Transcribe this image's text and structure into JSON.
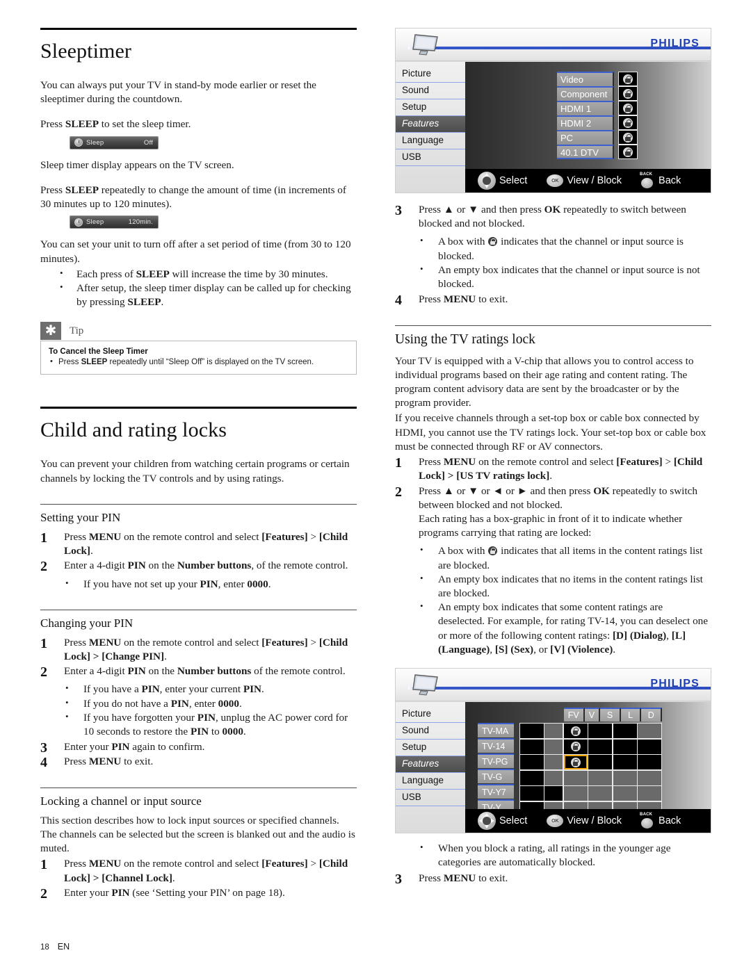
{
  "footer": {
    "page_number": "18",
    "language_code": "EN"
  },
  "left": {
    "chapter1": {
      "title": "Sleeptimer",
      "p1": "You can always put your TV in stand-by mode earlier or reset the sleeptimer during the countdown.",
      "p2_pre": "Press ",
      "p2_bold": "SLEEP",
      "p2_post": " to set the sleep timer.",
      "badge1": {
        "icon": "clock-icon",
        "label": "Sleep",
        "value": "Off"
      },
      "p3": "Sleep timer display appears on the TV screen.",
      "p4_pre": "Press ",
      "p4_bold": "SLEEP",
      "p4_post": " repeatedly to change the amount of time (in increments of 30 minutes up to 120 minutes).",
      "badge2": {
        "icon": "clock-icon",
        "label": "Sleep",
        "value": "120min."
      },
      "p5": "You can set your unit to turn off after a set period of time (from 30 to 120 minutes).",
      "bullets": [
        {
          "pre": "Each press of ",
          "bold": "SLEEP",
          "post": " will increase the time by 30 minutes."
        },
        {
          "pre": "After setup, the sleep timer display can be called up for checking by pressing ",
          "bold": "SLEEP",
          "post": "."
        }
      ],
      "tip": {
        "icon": "asterisk-icon",
        "header": "Tip",
        "title": "To Cancel the Sleep Timer",
        "body_pre": "Press ",
        "body_bold": "SLEEP",
        "body_post": " repeatedly until “Sleep Off” is displayed on the TV screen."
      }
    },
    "chapter2": {
      "title": "Child and rating locks",
      "intro": "You can prevent your children from watching certain programs or certain channels by locking the TV controls and by using ratings.",
      "sections": [
        {
          "heading": "Setting your PIN",
          "steps": [
            {
              "num": "1",
              "pre": "Press ",
              "b1": "MENU",
              "mid": " on the remote control and select ",
              "b2": "[Features]",
              "post": " > ",
              "b3": "[Child Lock]",
              "tail": "."
            },
            {
              "num": "2",
              "pre": "Enter a 4-digit ",
              "b1": "PIN",
              "mid": " on the ",
              "b2": "Number buttons",
              "post": ", of the remote control.",
              "b3": "",
              "tail": ""
            }
          ],
          "bullets": [
            {
              "pre": "If you have not set up your ",
              "b1": "PIN",
              "mid": ", enter ",
              "b2": "0000",
              "post": "."
            }
          ]
        },
        {
          "heading": "Changing your PIN",
          "steps": [
            {
              "num": "1",
              "pre": "Press ",
              "b1": "MENU",
              "mid": " on the remote control and select ",
              "b2": "[Features]",
              "post": " > ",
              "b3": "[Child Lock] > [Change PIN]",
              "tail": "."
            },
            {
              "num": "2",
              "pre": "Enter a 4-digit ",
              "b1": "PIN",
              "mid": " on the ",
              "b2": "Number buttons",
              "post": " of the remote control.",
              "b3": "",
              "tail": ""
            }
          ],
          "bullets": [
            {
              "pre": "If you have a ",
              "b1": "PIN",
              "mid": ", enter your current ",
              "b2": "PIN",
              "post": "."
            },
            {
              "pre": "If you do not have a ",
              "b1": "PIN",
              "mid": ", enter ",
              "b2": "0000",
              "post": "."
            },
            {
              "pre": "If you have forgotten your ",
              "b1": "PIN",
              "mid": ", unplug the AC power cord for 10 seconds to restore the ",
              "b2": "PIN",
              "post": " to ",
              "b3": "0000",
              "tail": "."
            }
          ],
          "steps_after": [
            {
              "num": "3",
              "pre": "Enter your ",
              "b1": "PIN",
              "mid": " again to confirm.",
              "b2": "",
              "post": ""
            },
            {
              "num": "4",
              "pre": "Press ",
              "b1": "MENU",
              "mid": " to exit.",
              "b2": "",
              "post": ""
            }
          ]
        },
        {
          "heading": "Locking a channel or input source",
          "intro": "This section describes how to lock input sources or specified channels. The channels can be selected but the screen is blanked out and the audio is muted.",
          "steps": [
            {
              "num": "1",
              "pre": "Press ",
              "b1": "MENU",
              "mid": " on the remote control and select ",
              "b2": "[Features]",
              "post": " > ",
              "b3": "[Child Lock] > [Channel Lock]",
              "tail": "."
            },
            {
              "num": "2",
              "pre": "Enter your ",
              "b1": "PIN",
              "mid": " (see ‘Setting your PIN’ on page 18).",
              "b2": "",
              "post": ""
            }
          ]
        }
      ]
    }
  },
  "right": {
    "tv1": {
      "brand": "PHILIPS",
      "tv_icon": "tv-screen-icon",
      "nav": [
        {
          "label": "Picture",
          "selected": false
        },
        {
          "label": "Sound",
          "selected": false
        },
        {
          "label": "Setup",
          "selected": false
        },
        {
          "label": "Features",
          "selected": true
        },
        {
          "label": "Language",
          "selected": false
        },
        {
          "label": "USB",
          "selected": false
        }
      ],
      "sources": [
        {
          "label": "Video",
          "locked": true
        },
        {
          "label": "Component",
          "locked": true
        },
        {
          "label": "HDMI 1",
          "locked": true
        },
        {
          "label": "HDMI 2",
          "locked": true
        },
        {
          "label": "PC",
          "locked": true
        },
        {
          "label": "40.1 DTV",
          "locked": true
        }
      ],
      "footbar": [
        {
          "icon": "dpad-updown-icon",
          "label": "Select"
        },
        {
          "icon": "ok-button-icon",
          "label": "View / Block"
        },
        {
          "icon": "back-button-icon",
          "label": "Back"
        }
      ]
    },
    "steps_after_tv1": [
      {
        "num": "3",
        "pre": "Press ▲ or ▼ and then press ",
        "b1": "OK",
        "mid": " repeatedly to switch between blocked and not blocked.",
        "b2": "",
        "post": ""
      }
    ],
    "bullets_after_tv1": [
      {
        "pre": "A box with ",
        "icon": "lock-icon",
        "post": " indicates that the channel or input source is blocked."
      },
      {
        "pre": "An empty box indicates that the channel or input source is not blocked.",
        "icon": "",
        "post": ""
      }
    ],
    "step4": {
      "num": "4",
      "pre": "Press ",
      "b1": "MENU",
      "mid": " to exit.",
      "b2": "",
      "post": ""
    },
    "ratings_section": {
      "heading": "Using the TV ratings lock",
      "p1": "Your TV is equipped with a V-chip that allows you to control access to individual programs based on their age rating and content rating. The program content advisory data are sent by the broadcaster or by the program provider.",
      "p2": "If you receive channels through a set-top box or cable box connected by HDMI, you cannot use the TV ratings lock. Your set-top box or cable box must be connected through RF or AV connectors.",
      "steps": [
        {
          "num": "1",
          "pre": "Press ",
          "b1": "MENU",
          "mid": " on the remote control and select ",
          "b2": "[Features]",
          "post": " > ",
          "b3": "[Child Lock] > [US TV ratings lock]",
          "tail": "."
        },
        {
          "num": "2",
          "pre": "Press ▲ or ▼ or ◄ or ► and then press ",
          "b1": "OK",
          "mid": " repeatedly to switch between blocked and not blocked.",
          "b2": "",
          "post": ""
        }
      ],
      "step2_cont": "Each rating has a box-graphic in front of it to indicate whether programs carrying that rating are locked:",
      "bullets": [
        {
          "pre": "A box with ",
          "icon": "lock-icon",
          "post": " indicates that all items in the content ratings list are blocked."
        },
        {
          "pre": "An empty box indicates that no items in the content ratings list are blocked.",
          "icon": "",
          "post": ""
        },
        {
          "pre": "An empty box indicates that some content ratings are deselected. For example, for rating TV-14, you can deselect one or more of the following content ratings: ",
          "icon": "",
          "post": "",
          "b1": "[D]",
          "b1b": " (Dialog)",
          "b2": "[L]",
          "b2b": " (Language)",
          "b3": "[S]",
          "b3b": " (Sex)",
          "b4": "[V]",
          "b4b": " (Violence)"
        }
      ]
    },
    "tv2": {
      "brand": "PHILIPS",
      "tv_icon": "tv-screen-icon",
      "nav": [
        {
          "label": "Picture",
          "selected": false
        },
        {
          "label": "Sound",
          "selected": false
        },
        {
          "label": "Setup",
          "selected": false
        },
        {
          "label": "Features",
          "selected": true
        },
        {
          "label": "Language",
          "selected": false
        },
        {
          "label": "USB",
          "selected": false
        }
      ],
      "column_headers": [
        "FV",
        "V",
        "S",
        "L",
        "D"
      ],
      "row_labels": [
        "TV-MA",
        "TV-14",
        "TV-PG",
        "TV-G",
        "TV-Y7",
        "TV-Y"
      ],
      "grid": [
        [
          "k",
          "g",
          "k-lock",
          "k",
          "k",
          "g"
        ],
        [
          "k",
          "g",
          "k-lock",
          "k",
          "k",
          "k"
        ],
        [
          "k",
          "g",
          "k-lock-hl",
          "k",
          "k",
          "k"
        ],
        [
          "k",
          "g",
          "g",
          "g",
          "g",
          "g"
        ],
        [
          "k",
          "k",
          "g",
          "g",
          "g",
          "g"
        ],
        [
          "k",
          "g",
          "g",
          "g",
          "g",
          "g"
        ]
      ],
      "highlight_color": "#f0a500",
      "footbar": [
        {
          "icon": "dpad-icon",
          "label": "Select"
        },
        {
          "icon": "ok-button-icon",
          "label": "View / Block"
        },
        {
          "icon": "back-button-icon",
          "label": "Back"
        }
      ]
    },
    "bullets_after_tv2": [
      {
        "text": "When you block a rating, all ratings in the younger age categories are automatically blocked."
      }
    ],
    "step3_final": {
      "num": "3",
      "pre": "Press ",
      "b1": "MENU",
      "mid": " to exit.",
      "b2": "",
      "post": ""
    }
  }
}
